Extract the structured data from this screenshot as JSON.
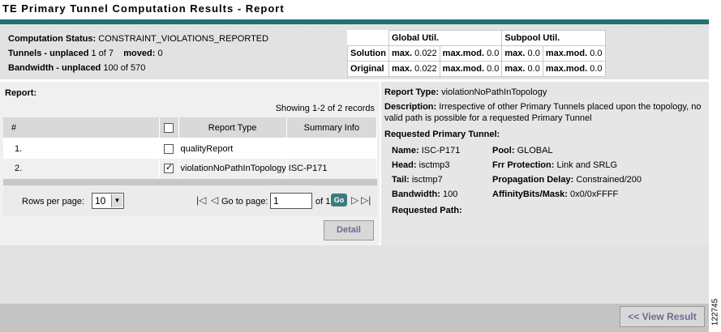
{
  "title": "TE Primary Tunnel Computation Results - Report",
  "summary": {
    "status_label": "Computation Status:",
    "status_value": "CONSTRAINT_VIOLATIONS_REPORTED",
    "tunnels_label": "Tunnels - unplaced",
    "tunnels_value": "1 of 7",
    "moved_label": "moved:",
    "moved_value": "0",
    "bandwidth_label": "Bandwidth - unplaced",
    "bandwidth_value": "100 of 570"
  },
  "util": {
    "global_header": "Global Util.",
    "subpool_header": "Subpool Util.",
    "max_label": "max.",
    "maxmod_label": "max.mod.",
    "rows": [
      {
        "label": "Solution",
        "g_max": "0.022",
        "g_maxmod": "0.0",
        "s_max": "0.0",
        "s_maxmod": "0.0"
      },
      {
        "label": "Original",
        "g_max": "0.022",
        "g_maxmod": "0.0",
        "s_max": "0.0",
        "s_maxmod": "0.0"
      }
    ]
  },
  "report": {
    "label": "Report:",
    "showing": "Showing 1-2 of 2 records",
    "columns": {
      "num": "#",
      "type": "Report Type",
      "summary": "Summary Info"
    },
    "rows": [
      {
        "num": "1.",
        "type": "qualityReport",
        "summary": "",
        "checked": false
      },
      {
        "num": "2.",
        "type": "violationNoPathInTopology",
        "summary": "ISC-P171",
        "checked": true
      }
    ],
    "rows_per_page_label": "Rows per page:",
    "rows_per_page_value": "10",
    "goto_label": "Go to page:",
    "goto_value": "1",
    "of_pages": "of 1",
    "go_label": "Go",
    "detail_label": "Detail"
  },
  "detail": {
    "type_label": "Report Type:",
    "type_value": "violationNoPathInTopology",
    "desc_label": "Description:",
    "desc_value": "Irrespective of other Primary Tunnels placed upon the topology, no valid path is possible for a requested Primary Tunnel",
    "req_label": "Requested Primary Tunnel:",
    "name_label": "Name:",
    "name_value": "ISC-P171",
    "head_label": "Head:",
    "head_value": "isctmp3",
    "tail_label": "Tail:",
    "tail_value": "isctmp7",
    "bw_label": "Bandwidth:",
    "bw_value": "100",
    "pool_label": "Pool:",
    "pool_value": "GLOBAL",
    "frr_label": "Frr Protection:",
    "frr_value": "Link and SRLG",
    "prop_label": "Propagation Delay:",
    "prop_value": "Constrained/200",
    "aff_label": "AffinityBits/Mask:",
    "aff_value": "0x0/0xFFFF",
    "path_label": "Requested Path:"
  },
  "footer": {
    "view_result_label": "<< View Result"
  },
  "figure_number": "122745"
}
